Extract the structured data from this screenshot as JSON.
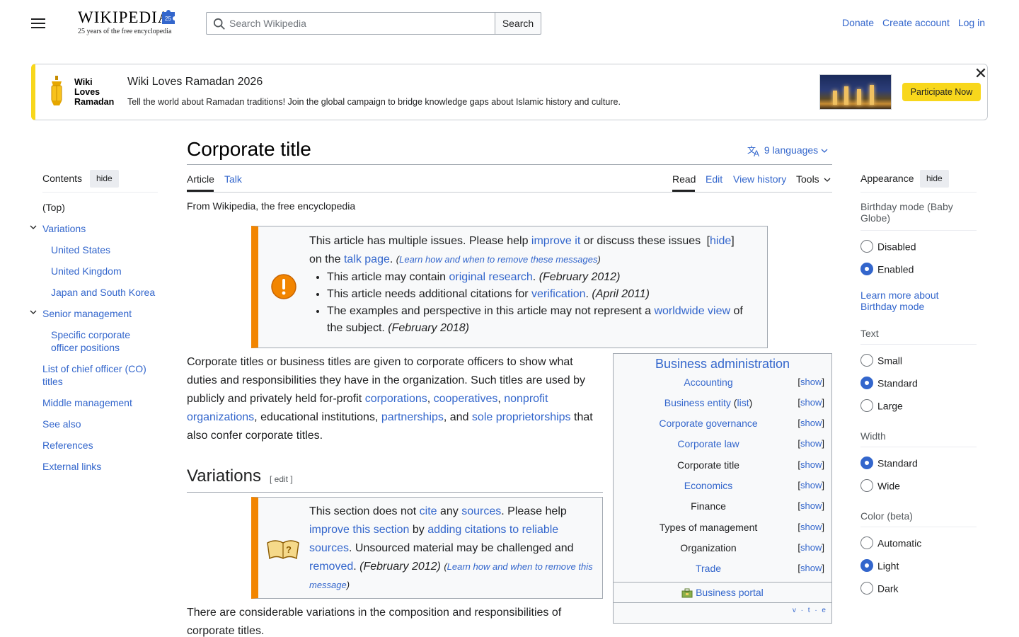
{
  "header": {
    "logo_wordmark": "WIKIPEDIA",
    "logo_badge": "25",
    "logo_tagline": "25 years of the free encyclopedia",
    "search_placeholder": "Search Wikipedia",
    "search_button": "Search",
    "user_links": [
      "Donate",
      "Create account",
      "Log in"
    ]
  },
  "banner": {
    "brand": [
      "Wiki",
      "Loves",
      "Ramadan"
    ],
    "title": "Wiki Loves Ramadan 2026",
    "text": "Tell the world about Ramadan traditions! Join the global campaign to bridge knowledge gaps about Islamic history and culture.",
    "cta": "Participate Now",
    "close": "✕",
    "accent": "#f8d71c"
  },
  "toc": {
    "title": "Contents",
    "hide": "hide",
    "items": [
      {
        "label": "(Top)",
        "level": 1
      },
      {
        "label": "Variations",
        "level": 1,
        "expandable": true
      },
      {
        "label": "United States",
        "level": 2
      },
      {
        "label": "United Kingdom",
        "level": 2
      },
      {
        "label": "Japan and South Korea",
        "level": 2
      },
      {
        "label": "Senior management",
        "level": 1,
        "expandable": true
      },
      {
        "label": "Specific corporate officer positions",
        "level": 2
      },
      {
        "label": "List of chief officer (CO) titles",
        "level": 1
      },
      {
        "label": "Middle management",
        "level": 1
      },
      {
        "label": "See also",
        "level": 1
      },
      {
        "label": "References",
        "level": 1
      },
      {
        "label": "External links",
        "level": 1
      }
    ]
  },
  "article": {
    "title": "Corporate title",
    "languages": "9 languages",
    "tabs_left": [
      "Article",
      "Talk"
    ],
    "tabs_right": [
      "Read",
      "Edit",
      "View history",
      "Tools"
    ],
    "from": "From Wikipedia, the free encyclopedia",
    "issues_box": {
      "intro_a": "This article has multiple issues. Please help ",
      "improve_link": "improve it",
      "intro_b": " or discuss these issues ",
      "hide_link": "hide",
      "on_the": "on the ",
      "talk_link": "talk page",
      "learn": "Learn how and when to remove these messages",
      "items": [
        {
          "a": "This article may contain ",
          "link": "original research",
          "b": ". ",
          "date": "(February 2012)"
        },
        {
          "a": "This article needs additional citations for ",
          "link": "verification",
          "b": ". ",
          "date": "(April 2011)"
        },
        {
          "a": "The examples and perspective in this article may not represent a ",
          "link": "worldwide view",
          "b": " of the subject. ",
          "date": "(February 2018)"
        }
      ]
    },
    "intro": {
      "t1": "Corporate titles or business titles are given to corporate officers to show what duties and responsibilities they have in the organization. Such titles are used by publicly and privately held for-profit ",
      "l1": "corporations",
      "t2": ", ",
      "l2": "cooperatives",
      "t3": ", ",
      "l3": "nonprofit organizations",
      "t4": ", educational institutions, ",
      "l4": "partnerships",
      "t5": ", and ",
      "l5": "sole proprietorships",
      "t6": " that also confer corporate titles."
    },
    "h2": "Variations",
    "h2_edit": "[ edit ]",
    "section_box": {
      "a": "This section does not ",
      "cite": "cite",
      "b": " any ",
      "sources": "sources",
      "c": ". Please help ",
      "improve": "improve this section",
      "d": " by ",
      "adding": "adding citations to reliable sources",
      "e": ". Unsourced material may be challenged and ",
      "removed": "removed",
      "f": ". ",
      "date": "(February 2012)",
      "learn": "Learn how and when to remove this message"
    },
    "variations_text": "There are considerable variations in the composition and responsibilities of corporate titles."
  },
  "navbox": {
    "title": "Business administration",
    "rows": [
      {
        "label": "Accounting",
        "link": true
      },
      {
        "label": "Business entity",
        "link": true,
        "extra": "list"
      },
      {
        "label": "Corporate governance",
        "link": true
      },
      {
        "label": "Corporate law",
        "link": true
      },
      {
        "label": "Corporate title",
        "link": false
      },
      {
        "label": "Economics",
        "link": true
      },
      {
        "label": "Finance",
        "link": false
      },
      {
        "label": "Types of management",
        "link": false
      },
      {
        "label": "Organization",
        "link": false
      },
      {
        "label": "Trade",
        "link": true
      }
    ],
    "show": "show",
    "portal": "Business portal",
    "vte": "v · t · e"
  },
  "appearance": {
    "title": "Appearance",
    "hide": "hide",
    "birthday": {
      "label": "Birthday mode (Baby Globe)",
      "options": [
        "Disabled",
        "Enabled"
      ],
      "selected": "Enabled"
    },
    "birthday_learn": "Learn more about Birthday mode",
    "text": {
      "label": "Text",
      "options": [
        "Small",
        "Standard",
        "Large"
      ],
      "selected": "Standard"
    },
    "width": {
      "label": "Width",
      "options": [
        "Standard",
        "Wide"
      ],
      "selected": "Standard"
    },
    "color": {
      "label": "Color (beta)",
      "options": [
        "Automatic",
        "Light",
        "Dark"
      ],
      "selected": "Light"
    }
  }
}
